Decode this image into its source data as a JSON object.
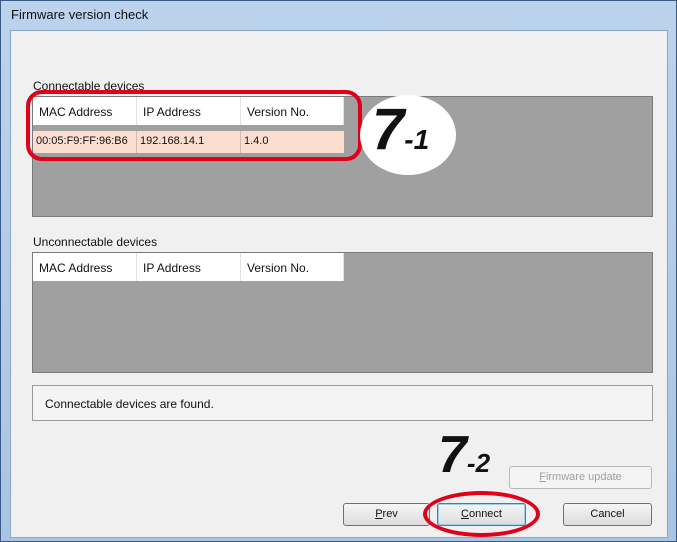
{
  "window": {
    "title": "Firmware version check"
  },
  "connectable": {
    "label": "Connectable devices",
    "columns": [
      "MAC Address",
      "IP Address",
      "Version No."
    ],
    "rows": [
      {
        "mac": "00:05:F9:FF:96:B6",
        "ip": "192.168.14.1",
        "version": "1.4.0"
      }
    ]
  },
  "unconnectable": {
    "label": "Unconnectable devices",
    "columns": [
      "MAC Address",
      "IP Address",
      "Version No."
    ],
    "rows": []
  },
  "status": {
    "text": "Connectable devices are found."
  },
  "buttons": {
    "firmware_update": {
      "mnemonic": "F",
      "rest": "irmware update"
    },
    "prev": {
      "mnemonic": "P",
      "rest": "rev"
    },
    "connect": {
      "mnemonic": "C",
      "rest": "onnect"
    },
    "cancel": "Cancel"
  },
  "callouts": {
    "step1": {
      "num": "7",
      "sub": "-1"
    },
    "step2": {
      "num": "7",
      "sub": "-2"
    }
  },
  "colors": {
    "highlight": "#e0001a",
    "selected_row": "#fcded0",
    "list_background": "#a0a0a0"
  }
}
